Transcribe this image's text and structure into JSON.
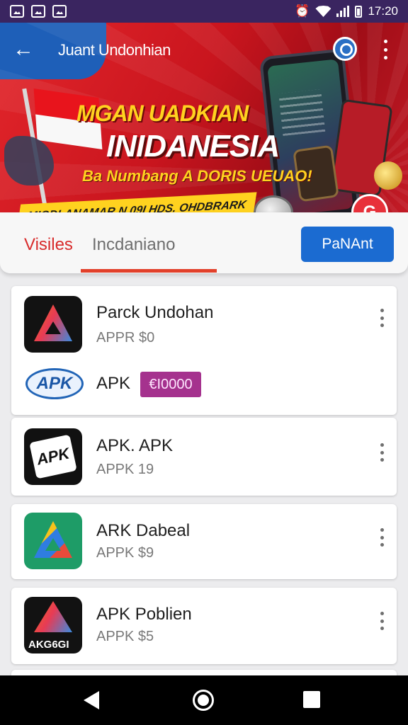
{
  "status_bar": {
    "time": "17:20"
  },
  "header": {
    "title": "Juant Undonhian"
  },
  "banner": {
    "headline1": "MGAN UADKIAN",
    "headline2": "INIDANESIA",
    "subline": "Ba Numbang A DORIS UEUAO!",
    "ribbon": "MIODLANAMAR N 09I HDS. OHDBRARK",
    "badge_glyph": "G"
  },
  "tabs": [
    {
      "label": "Visiles",
      "active": false
    },
    {
      "label": "Incdaniano",
      "active": true
    }
  ],
  "action_button": {
    "label": "PaNAnt"
  },
  "cards": [
    {
      "apps": [
        {
          "name": "Parck Undohan",
          "subtitle": "APPR $0"
        },
        {
          "name": "APK",
          "icon_text": "APK",
          "price": "€I0000"
        }
      ]
    },
    {
      "apps": [
        {
          "name": "APK. APK",
          "subtitle": "APPK 19",
          "icon_text": "APK"
        }
      ]
    },
    {
      "apps": [
        {
          "name": "ARK Dabeal",
          "subtitle": "APPK $9"
        }
      ]
    },
    {
      "apps": [
        {
          "name": "APK Poblien",
          "subtitle": "APPK $5",
          "icon_text": "AKG6GI"
        }
      ]
    }
  ],
  "colors": {
    "accent_red": "#d82c2c",
    "primary_blue": "#1b6bd1",
    "price_purple": "#a5328e",
    "status_bar": "#3a2560"
  },
  "icons": [
    "back-arrow-icon",
    "search-icon",
    "more-vert-icon",
    "nav-back-icon",
    "nav-home-icon",
    "nav-recents-icon"
  ]
}
